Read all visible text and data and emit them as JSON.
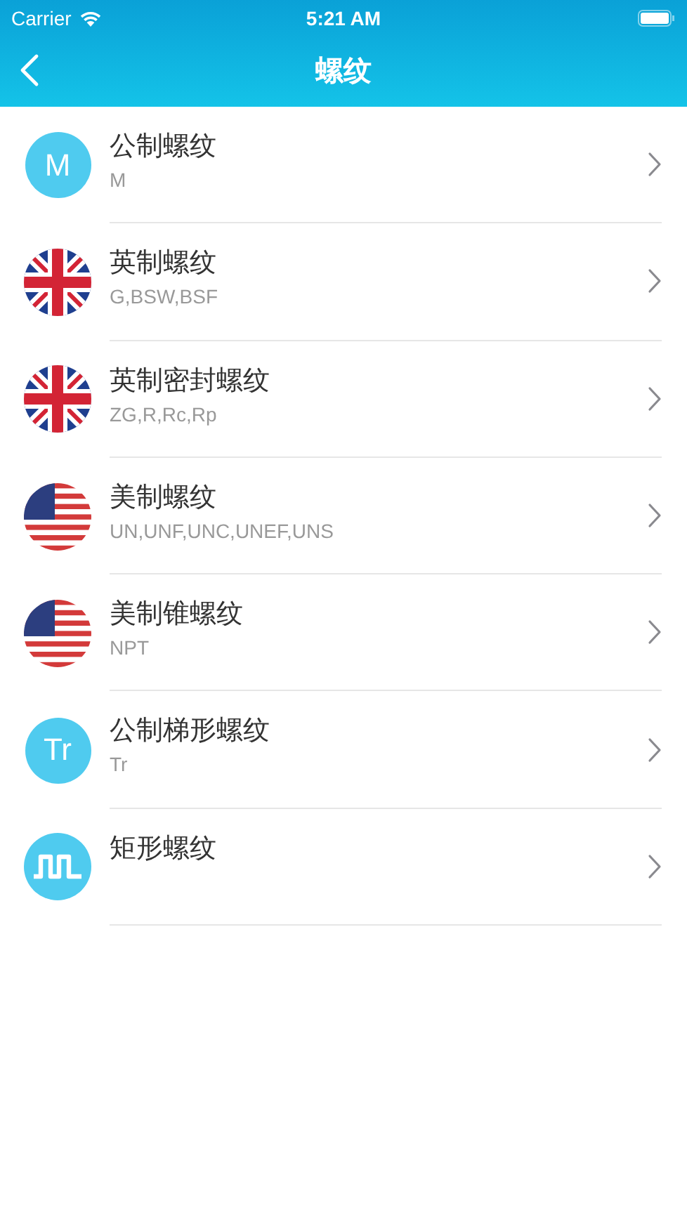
{
  "status_bar": {
    "carrier": "Carrier",
    "time": "5:21 AM"
  },
  "nav": {
    "title": "螺纹"
  },
  "items": [
    {
      "title": "公制螺纹",
      "subtitle": "M",
      "icon": {
        "kind": "letter",
        "text": "M"
      }
    },
    {
      "title": "英制螺纹",
      "subtitle": "G,BSW,BSF",
      "icon": {
        "kind": "uk-flag"
      }
    },
    {
      "title": "英制密封螺纹",
      "subtitle": "ZG,R,Rc,Rp",
      "icon": {
        "kind": "uk-flag"
      }
    },
    {
      "title": "美制螺纹",
      "subtitle": "UN,UNF,UNC,UNEF,UNS",
      "icon": {
        "kind": "us-flag"
      }
    },
    {
      "title": "美制锥螺纹",
      "subtitle": "NPT",
      "icon": {
        "kind": "us-flag"
      }
    },
    {
      "title": "公制梯形螺纹",
      "subtitle": "Tr",
      "icon": {
        "kind": "letter",
        "text": "Tr"
      }
    },
    {
      "title": "矩形螺纹",
      "icon": {
        "kind": "wave"
      }
    }
  ]
}
